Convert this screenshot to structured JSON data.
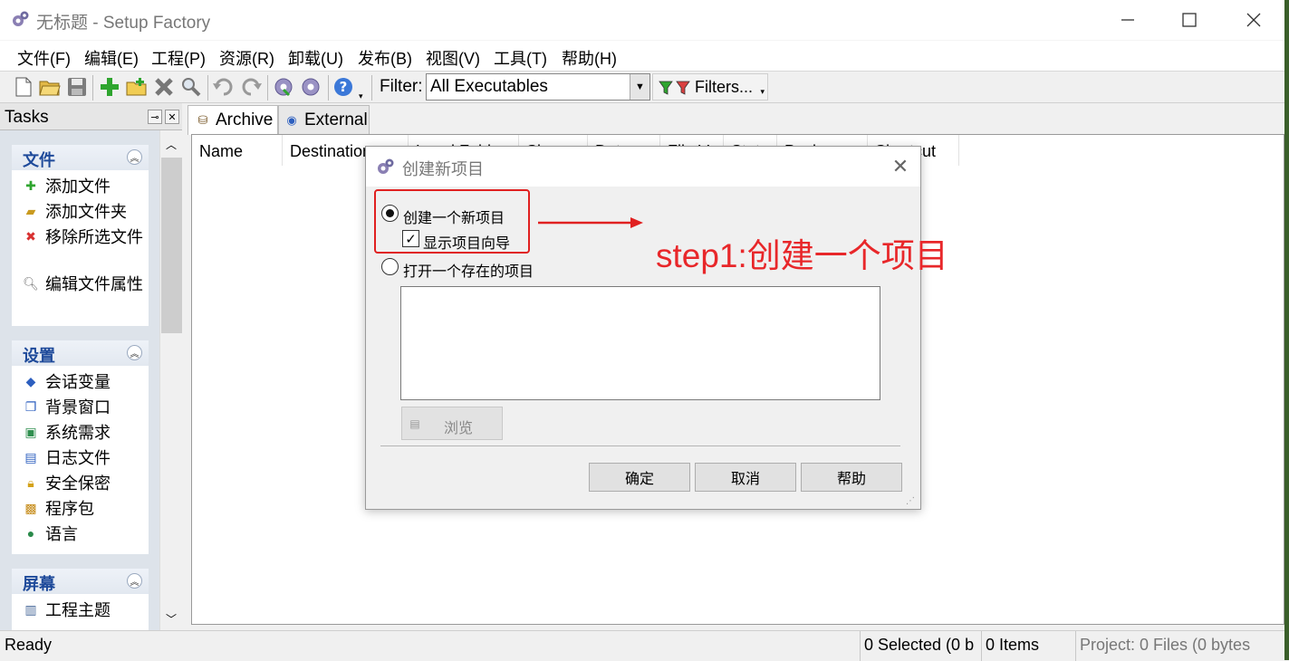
{
  "window": {
    "title": "无标题 - Setup Factory",
    "controls": {
      "minimize_icon": "minimize-icon",
      "maximize_icon": "maximize-icon",
      "close_icon": "close-icon"
    }
  },
  "menu": {
    "items": [
      {
        "label": "文件(F)"
      },
      {
        "label": "编辑(E)"
      },
      {
        "label": "工程(P)"
      },
      {
        "label": "资源(R)"
      },
      {
        "label": "卸载(U)"
      },
      {
        "label": "发布(B)"
      },
      {
        "label": "视图(V)"
      },
      {
        "label": "工具(T)"
      },
      {
        "label": "帮助(H)"
      }
    ]
  },
  "toolbar": {
    "icons": [
      "new-project-icon",
      "open-project-icon",
      "save-icon",
      "add-files-icon",
      "add-folder-icon",
      "remove-icon",
      "search-icon",
      "undo-icon",
      "redo-icon",
      "build-icon",
      "settings-icon",
      "help-icon"
    ],
    "filter_label": "Filter:",
    "filter_value": "All Executables",
    "filters_button": "Filters..."
  },
  "tasks": {
    "title": "Tasks",
    "groups": [
      {
        "title": "文件",
        "items": [
          {
            "label": "添加文件",
            "icon": "add-icon"
          },
          {
            "label": "添加文件夹",
            "icon": "folder-add-icon"
          },
          {
            "label": "移除所选文件",
            "icon": "remove-icon"
          },
          {
            "label": "编辑文件属性",
            "icon": "edit-icon"
          }
        ]
      },
      {
        "title": "设置",
        "items": [
          {
            "label": "会话变量",
            "icon": "variables-icon"
          },
          {
            "label": "背景窗口",
            "icon": "window-icon"
          },
          {
            "label": "系统需求",
            "icon": "requirements-icon"
          },
          {
            "label": "日志文件",
            "icon": "log-icon"
          },
          {
            "label": "安全保密",
            "icon": "lock-icon"
          },
          {
            "label": "程序包",
            "icon": "package-icon"
          },
          {
            "label": "语言",
            "icon": "globe-icon"
          }
        ]
      },
      {
        "title": "屏幕",
        "items": [
          {
            "label": "工程主题",
            "icon": "theme-icon"
          }
        ]
      }
    ]
  },
  "tabs": [
    {
      "label": "Archive",
      "active": true
    },
    {
      "label": "External",
      "active": false
    }
  ],
  "file_list": {
    "columns": [
      "Name",
      "Destination",
      "Local Folder",
      "Size",
      "Date",
      "File Ve",
      "Stat",
      "Package",
      "Shortcut"
    ]
  },
  "status": {
    "ready": "Ready",
    "selected": "0 Selected (0 b",
    "items": "0 Items",
    "project": "Project: 0 Files (0 bytes"
  },
  "dialog": {
    "title": "创建新项目",
    "option_new": "创建一个新项目",
    "option_new_selected": true,
    "wizard_checkbox": "显示项目向导",
    "wizard_checked": true,
    "option_open": "打开一个存在的项目",
    "option_open_selected": false,
    "browse_button": "浏览",
    "ok_button": "确定",
    "cancel_button": "取消",
    "help_button": "帮助"
  },
  "annotation": {
    "text": "step1:创建一个项目",
    "color": "#e8272a"
  },
  "colors": {
    "task_group_title": "#1e4a9a",
    "annotation_red": "#e02020"
  }
}
